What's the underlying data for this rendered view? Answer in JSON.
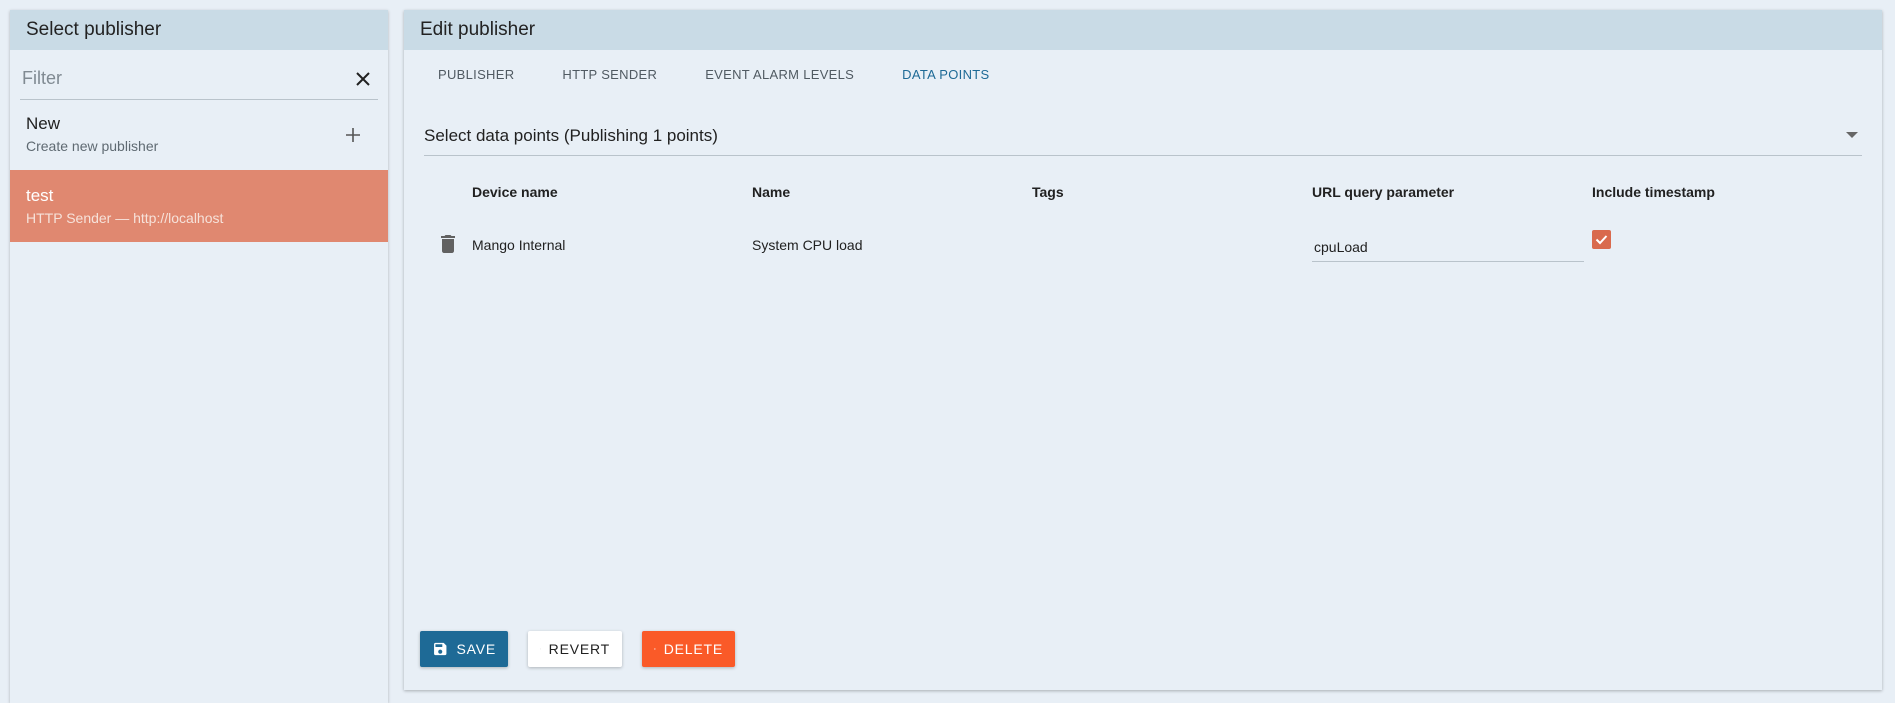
{
  "left": {
    "header": "Select publisher",
    "filter_placeholder": "Filter",
    "new_item": {
      "title": "New",
      "subtitle": "Create new publisher"
    },
    "publishers": [
      {
        "title": "test",
        "subtitle": "HTTP Sender — http://localhost"
      }
    ]
  },
  "right": {
    "header": "Edit publisher",
    "tabs": [
      "PUBLISHER",
      "HTTP SENDER",
      "EVENT ALARM LEVELS",
      "DATA POINTS"
    ],
    "active_tab": "DATA POINTS",
    "select_label": "Select data points (Publishing 1 points)",
    "table": {
      "headers": [
        "Device name",
        "Name",
        "Tags",
        "URL query parameter",
        "Include timestamp"
      ],
      "rows": [
        {
          "device": "Mango Internal",
          "name": "System CPU load",
          "tags": "",
          "url_param": "cpuLoad",
          "include_timestamp": true
        }
      ]
    },
    "buttons": {
      "save": "SAVE",
      "revert": "REVERT",
      "delete": "DELETE"
    }
  },
  "colors": {
    "accent": "#1e6a96",
    "selected_item": "#e08870",
    "checkbox": "#d96a4d",
    "delete": "#fa5a28",
    "header_bg": "#c9dbe6"
  }
}
